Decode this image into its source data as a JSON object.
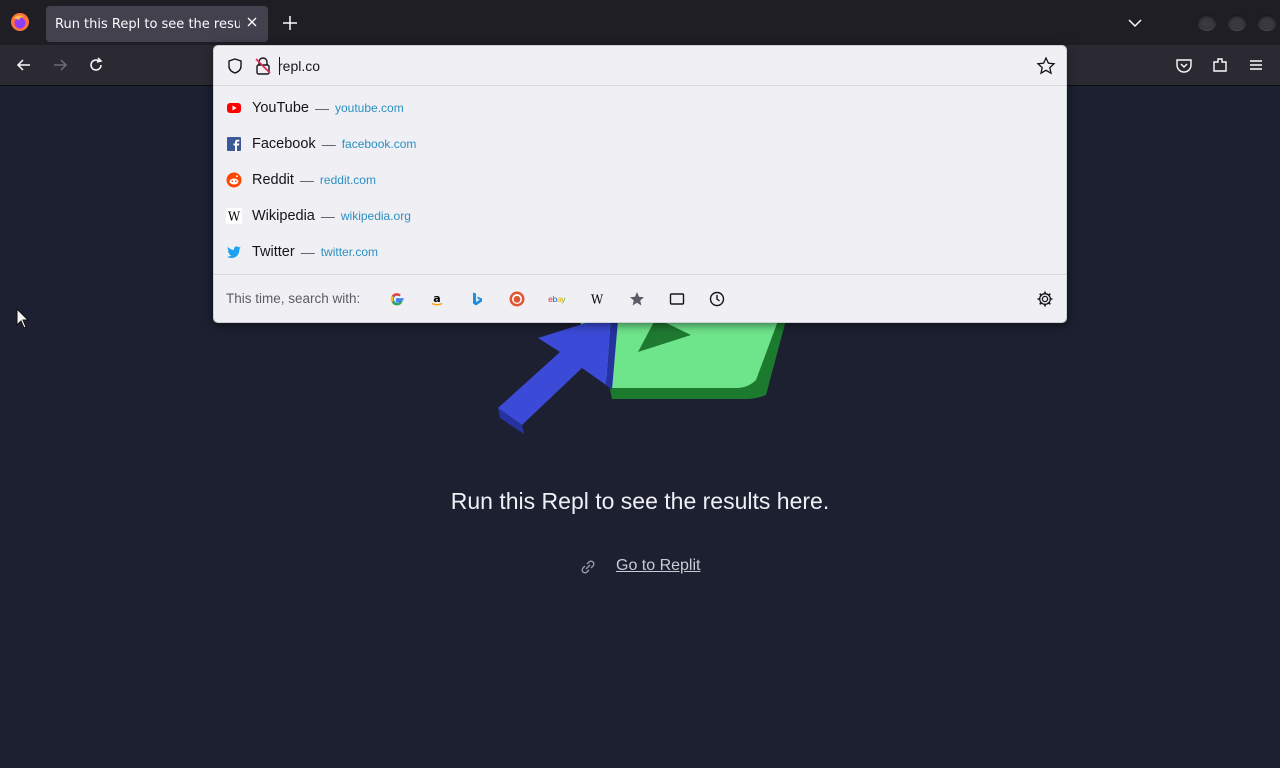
{
  "tabs": [
    {
      "title": "Run this Repl to see the results here."
    }
  ],
  "urlbar": {
    "value": "repl.co"
  },
  "suggestions": [
    {
      "name": "YouTube",
      "sep": "—",
      "url": "youtube.com"
    },
    {
      "name": "Facebook",
      "sep": "—",
      "url": "facebook.com"
    },
    {
      "name": "Reddit",
      "sep": "—",
      "url": "reddit.com"
    },
    {
      "name": "Wikipedia",
      "sep": "—",
      "url": "wikipedia.org"
    },
    {
      "name": "Twitter",
      "sep": "—",
      "url": "twitter.com"
    }
  ],
  "search_with_label": "This time, search with:",
  "search_engines": [
    "google-icon",
    "amazon-icon",
    "bing-icon",
    "duckduckgo-icon",
    "ebay-icon",
    "wikipedia-icon",
    "bookmarks-icon",
    "tabs-icon",
    "history-icon"
  ],
  "page": {
    "message": "Run this Repl to see the results here.",
    "link_label": "Go to Replit"
  },
  "colors": {
    "page_bg": "#1c2030",
    "link_blue": "#2a90c0",
    "toolbar": "#2b2a33"
  }
}
